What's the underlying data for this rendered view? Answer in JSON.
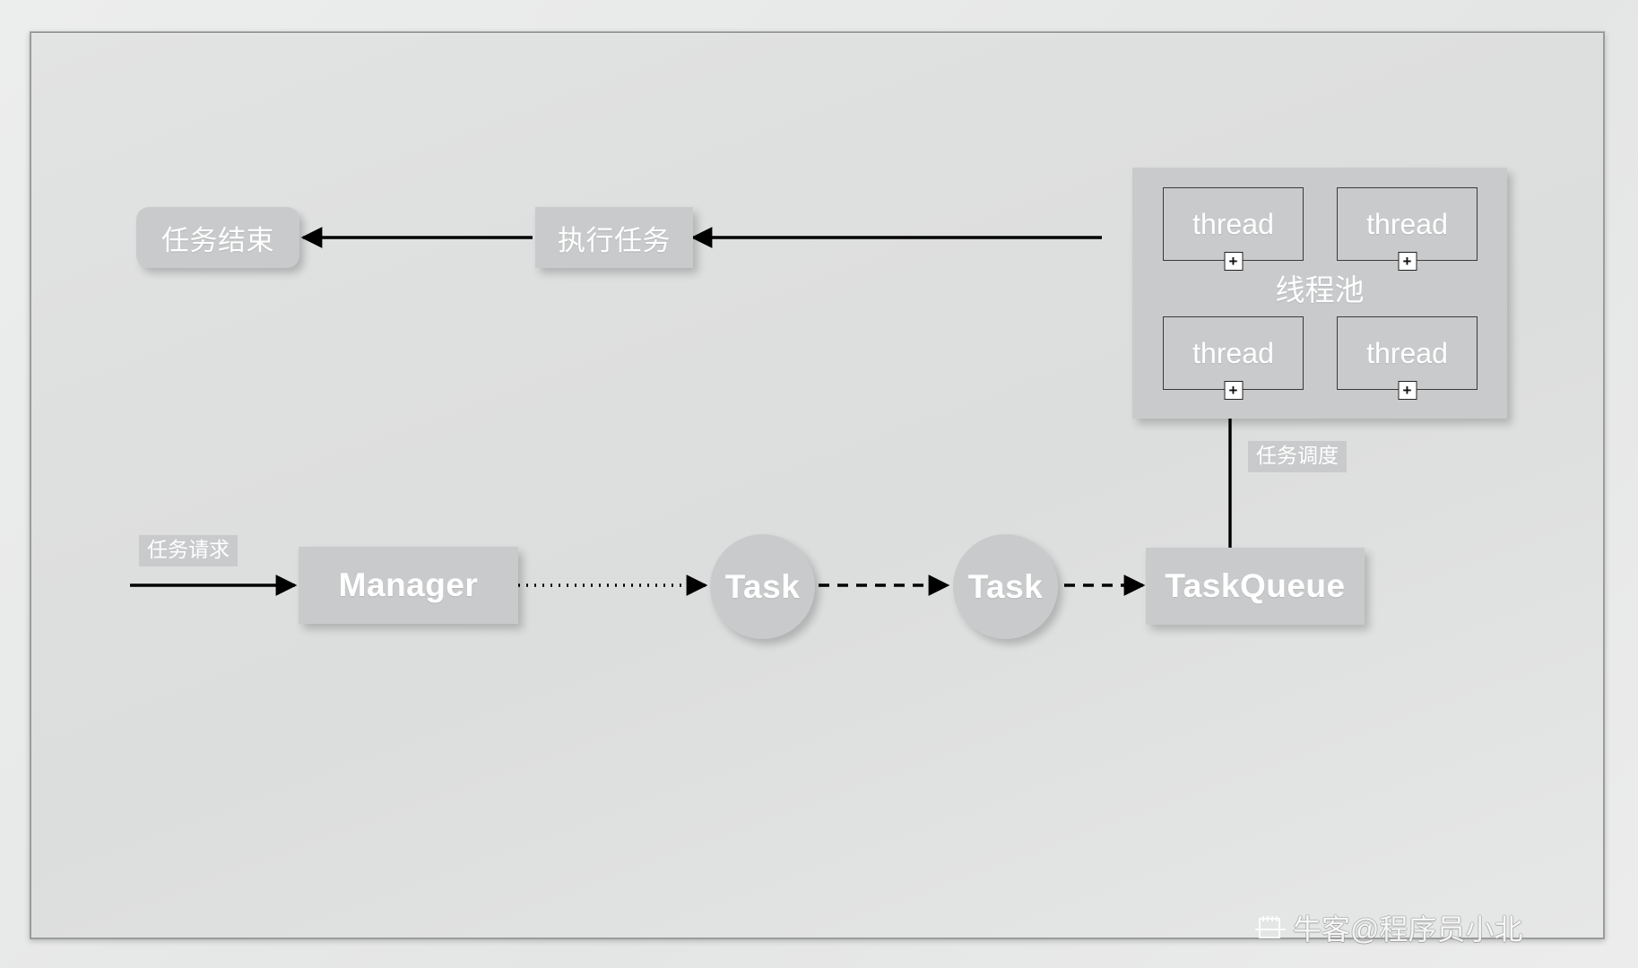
{
  "diagram": {
    "title_watermark": "牛客@程序员小北",
    "colors": {
      "node_fill": "#c9cacb",
      "node_text": "#ffffff",
      "canvas_fill": "#e0e1e1",
      "frame_border": "#9a9c9c",
      "connector": "#000000",
      "thread_border": "#3a3a3a"
    },
    "nodes": {
      "task_end": {
        "label": "任务结束",
        "shape": "rounded-rect"
      },
      "execute_task": {
        "label": "执行任务",
        "shape": "rect"
      },
      "thread_pool": {
        "label": "线程池",
        "shape": "rect",
        "threads": [
          {
            "label": "thread",
            "badge": "+"
          },
          {
            "label": "thread",
            "badge": "+"
          },
          {
            "label": "thread",
            "badge": "+"
          },
          {
            "label": "thread",
            "badge": "+"
          }
        ]
      },
      "manager": {
        "label": "Manager",
        "shape": "rect"
      },
      "task_1": {
        "label": "Task",
        "shape": "circle"
      },
      "task_2": {
        "label": "Task",
        "shape": "circle"
      },
      "task_queue": {
        "label": "TaskQueue",
        "shape": "rect"
      }
    },
    "edge_labels": {
      "task_request": "任务请求",
      "task_dispatch": "任务调度"
    },
    "edges": [
      {
        "from": "task_request_source",
        "to": "manager",
        "style": "solid",
        "arrow": "end"
      },
      {
        "from": "manager",
        "to": "task_1",
        "style": "dotted",
        "arrow": "end"
      },
      {
        "from": "task_1",
        "to": "task_2",
        "style": "dashed",
        "arrow": "end"
      },
      {
        "from": "task_2",
        "to": "task_queue",
        "style": "dashed",
        "arrow": "end"
      },
      {
        "from": "task_queue",
        "to": "thread_pool",
        "style": "solid",
        "arrow": "end",
        "label": "任务调度"
      },
      {
        "from": "thread_pool",
        "to": "execute_task",
        "style": "solid",
        "arrow": "end"
      },
      {
        "from": "execute_task",
        "to": "task_end",
        "style": "solid",
        "arrow": "end"
      }
    ]
  }
}
